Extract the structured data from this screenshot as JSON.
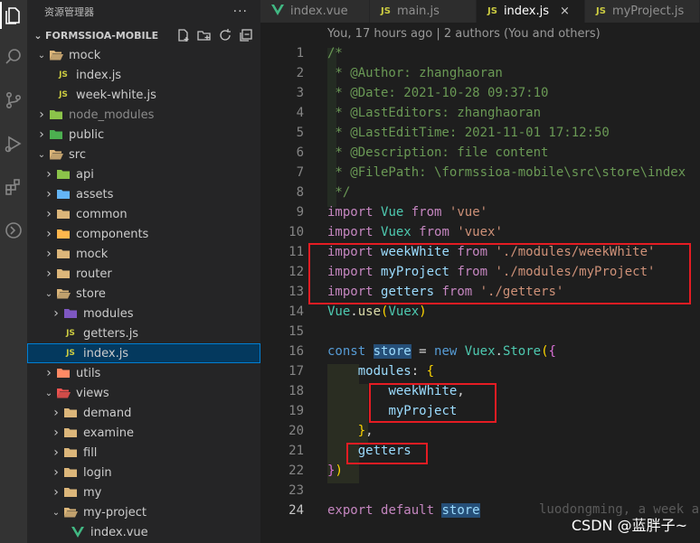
{
  "sidebar": {
    "title": "资源管理器",
    "more": "···",
    "project": "FORMSSIOA-MOBILE",
    "items": [
      {
        "label": "mock",
        "type": "folder",
        "open": true
      },
      {
        "label": "index.js",
        "type": "js"
      },
      {
        "label": "week-white.js",
        "type": "js"
      },
      {
        "label": "node_modules",
        "type": "folder-node"
      },
      {
        "label": "public",
        "type": "folder-public"
      },
      {
        "label": "src",
        "type": "folder",
        "open": true
      },
      {
        "label": "api",
        "type": "folder-api"
      },
      {
        "label": "assets",
        "type": "folder-assets"
      },
      {
        "label": "common",
        "type": "folder"
      },
      {
        "label": "components",
        "type": "folder-components"
      },
      {
        "label": "mock",
        "type": "folder"
      },
      {
        "label": "router",
        "type": "folder"
      },
      {
        "label": "store",
        "type": "folder",
        "open": true
      },
      {
        "label": "modules",
        "type": "folder-modules"
      },
      {
        "label": "getters.js",
        "type": "js"
      },
      {
        "label": "index.js",
        "type": "js",
        "selected": true
      },
      {
        "label": "utils",
        "type": "folder-utils"
      },
      {
        "label": "views",
        "type": "folder-views",
        "open": true
      },
      {
        "label": "demand",
        "type": "folder"
      },
      {
        "label": "examine",
        "type": "folder"
      },
      {
        "label": "fill",
        "type": "folder"
      },
      {
        "label": "login",
        "type": "folder"
      },
      {
        "label": "my",
        "type": "folder"
      },
      {
        "label": "my-project",
        "type": "folder",
        "open": true
      },
      {
        "label": "index.vue",
        "type": "vue"
      }
    ]
  },
  "tabs": [
    {
      "label": "index.vue",
      "icon": "vue"
    },
    {
      "label": "main.js",
      "icon": "js"
    },
    {
      "label": "index.js",
      "icon": "js",
      "active": true,
      "close": "×"
    },
    {
      "label": "myProject.js",
      "icon": "js"
    }
  ],
  "editor": {
    "blame_header": "You, 17 hours ago | 2 authors (You and others)",
    "line_numbers": [
      "1",
      "2",
      "3",
      "4",
      "5",
      "6",
      "7",
      "8",
      "9",
      "10",
      "11",
      "12",
      "13",
      "14",
      "15",
      "16",
      "17",
      "18",
      "19",
      "20",
      "21",
      "22",
      "23",
      "24"
    ],
    "comment": {
      "open": "/*",
      "author": " * @Author: zhanghaoran",
      "date": " * @Date: 2021-10-28 09:37:10",
      "last_editors": " * @LastEditors: zhanghaoran",
      "last_edit_time": " * @LastEditTime: 2021-11-01 17:12:50",
      "description": " * @Description: file content",
      "filepath": " * @FilePath: \\formssioa-mobile\\src\\store\\index",
      "close": " */"
    },
    "kw_import": "import",
    "kw_from": "from",
    "kw_const": "const",
    "kw_new": "new",
    "kw_export": "export",
    "kw_default": "default",
    "id_vue": "Vue",
    "id_vuex": "Vuex",
    "id_weekwhite": "weekWhite",
    "id_myproject": "myProject",
    "id_getters": "getters",
    "id_store": "store",
    "id_modules": "modules",
    "id_use": "use",
    "id_Store": "Store",
    "str_vue": "'vue'",
    "str_vuex": "'vuex'",
    "str_weekwhite": "'./modules/weekWhite'",
    "str_myproject": "'./modules/myProject'",
    "str_getters": "'./getters'",
    "inline_blame": "luodongming, a week a",
    "watermark": "CSDN @蓝胖子~"
  },
  "colors": {
    "red_box": "#e51c23",
    "selected_row": "#04395e"
  }
}
